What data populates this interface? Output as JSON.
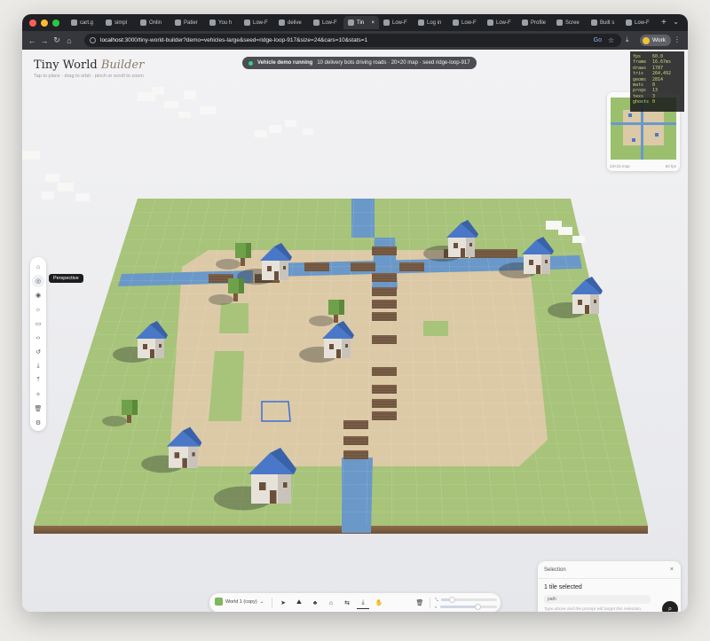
{
  "browser": {
    "tabs": [
      {
        "label": "cart.g",
        "active": false
      },
      {
        "label": "simpl",
        "active": false
      },
      {
        "label": "Onlin",
        "active": false
      },
      {
        "label": "Patier",
        "active": false
      },
      {
        "label": "You h",
        "active": false
      },
      {
        "label": "Low-F",
        "active": false
      },
      {
        "label": "delive",
        "active": false
      },
      {
        "label": "Low-F",
        "active": false
      },
      {
        "label": "Tin",
        "active": true
      },
      {
        "label": "Low-F",
        "active": false
      },
      {
        "label": "Log in",
        "active": false
      },
      {
        "label": "Low-F",
        "active": false
      },
      {
        "label": "Low-F",
        "active": false
      },
      {
        "label": "Profile",
        "active": false
      },
      {
        "label": "Scree",
        "active": false
      },
      {
        "label": "Built s",
        "active": false
      },
      {
        "label": "Low-F",
        "active": false
      }
    ],
    "new_tab": "+",
    "url_host": "localhost",
    "url_rest": ":3000/tiny-world-builder?demo=vehicles-large&seed=ridge-loop-917&size=24&cars=10&stats=1",
    "profile": "Work"
  },
  "app": {
    "brand_main": "Tiny World",
    "brand_accent": "Builder",
    "hint": "Tap to place · drag to orbit · pinch or scroll to zoom",
    "status": {
      "title": "Vehicle demo running",
      "detail": "10 delivery bots driving roads · 20×20 map · seed ridge-loop-917"
    },
    "stats": [
      {
        "k": "fps",
        "v": "60.0"
      },
      {
        "k": "frame",
        "v": "16.67ms"
      },
      {
        "k": "draws",
        "v": "1787"
      },
      {
        "k": "tris",
        "v": "264,492"
      },
      {
        "k": "geoms",
        "v": "2814"
      },
      {
        "k": "mats",
        "v": "8"
      },
      {
        "k": "progs",
        "v": "13"
      },
      {
        "k": "texs",
        "v": "3"
      },
      {
        "k": "ghosts",
        "v": "0"
      }
    ],
    "minimap": {
      "label": "23×23 map",
      "fps": "60 fps"
    },
    "tooltip": "Perspective",
    "sidebar_icons": [
      "home-icon",
      "perspective-icon",
      "eye-icon",
      "sun-icon",
      "layers-icon",
      "code-icon",
      "undo-icon",
      "download-icon",
      "upload-icon",
      "wand-icon",
      "trash-icon",
      "settings-icon"
    ],
    "selection": {
      "title": "Selection",
      "count": "1 tile selected",
      "tag": "path",
      "placeholder": "Type above and the prompt will target this selection."
    },
    "toolbar": {
      "world_name": "World 1 (copy)",
      "tools": [
        "select-icon",
        "terrain-icon",
        "tree-icon",
        "house-icon",
        "road-icon",
        "path-icon",
        "hand-icon"
      ],
      "active_tool": "path-icon",
      "sliders": [
        {
          "name": "height",
          "value": 0.2
        },
        {
          "name": "brush",
          "value": 0.65
        }
      ]
    }
  },
  "colors": {
    "grass": "#a7c47a",
    "path": "#dcc9a6",
    "water": "#6a98c8",
    "house_roof": "#4a78c8",
    "accent": "#3d6fd6"
  }
}
